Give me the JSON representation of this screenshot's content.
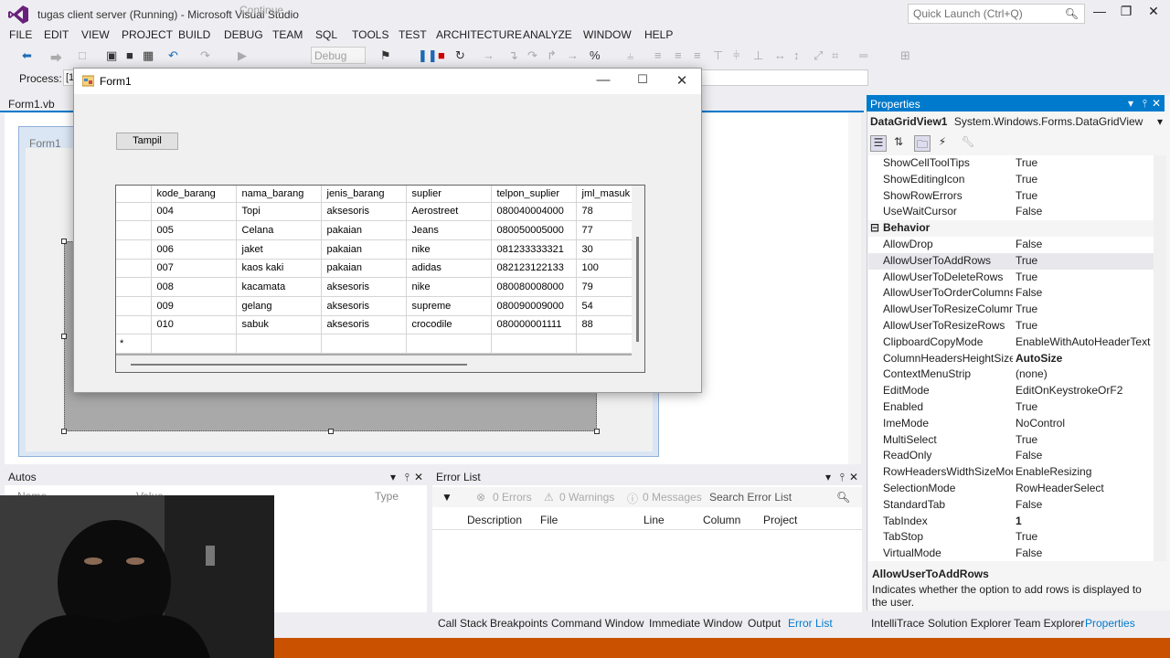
{
  "window": {
    "title": "tugas client server (Running) - Microsoft Visual Studio"
  },
  "quick_launch": {
    "placeholder": "Quick Launch (Ctrl+Q)"
  },
  "menu": [
    "FILE",
    "EDIT",
    "VIEW",
    "PROJECT",
    "BUILD",
    "DEBUG",
    "TEAM",
    "SQL",
    "TOOLS",
    "TEST",
    "ARCHITECTURE",
    "ANALYZE",
    "WINDOW",
    "HELP"
  ],
  "toolbar": {
    "continue_label": "Continue",
    "config_value": "Debug"
  },
  "process": {
    "label": "Process:",
    "value": "[1"
  },
  "document_tab": {
    "label": "Form1.vb"
  },
  "designer": {
    "form_title": "Form1"
  },
  "form1": {
    "title": "Form1",
    "button_label": "Tampil",
    "grid": {
      "columns": [
        "kode_barang",
        "nama_barang",
        "jenis_barang",
        "suplier",
        "telpon_suplier",
        "jml_masuk"
      ],
      "rows": [
        [
          "004",
          "Topi",
          "aksesoris",
          "Aerostreet",
          "080040004000",
          "78"
        ],
        [
          "005",
          "Celana",
          "pakaian",
          "Jeans",
          "080050005000",
          "77"
        ],
        [
          "006",
          "jaket",
          "pakaian",
          "nike",
          "081233333321",
          "30"
        ],
        [
          "007",
          "kaos kaki",
          "pakaian",
          "adidas",
          "082123122133",
          "100"
        ],
        [
          "008",
          "kacamata",
          "aksesoris",
          "nike",
          "080080008000",
          "79"
        ],
        [
          "009",
          "gelang",
          "aksesoris",
          "supreme",
          "080090009000",
          "54"
        ],
        [
          "010",
          "sabuk",
          "aksesoris",
          "crocodile",
          "080000001111",
          "88"
        ]
      ],
      "new_row_marker": "*"
    }
  },
  "properties": {
    "title": "Properties",
    "object_name": "DataGridView1",
    "object_type": "System.Windows.Forms.DataGridView",
    "rows": [
      {
        "name": "ShowCellToolTips",
        "value": "True"
      },
      {
        "name": "ShowEditingIcon",
        "value": "True"
      },
      {
        "name": "ShowRowErrors",
        "value": "True"
      },
      {
        "name": "UseWaitCursor",
        "value": "False"
      },
      {
        "category": "Behavior"
      },
      {
        "name": "AllowDrop",
        "value": "False"
      },
      {
        "name": "AllowUserToAddRows",
        "value": "True"
      },
      {
        "name": "AllowUserToDeleteRows",
        "value": "True"
      },
      {
        "name": "AllowUserToOrderColumns",
        "value": "False"
      },
      {
        "name": "AllowUserToResizeColumns",
        "value": "True"
      },
      {
        "name": "AllowUserToResizeRows",
        "value": "True"
      },
      {
        "name": "ClipboardCopyMode",
        "value": "EnableWithAutoHeaderText"
      },
      {
        "name": "ColumnHeadersHeightSizeMode",
        "value": "AutoSize",
        "bold": true
      },
      {
        "name": "ContextMenuStrip",
        "value": "(none)"
      },
      {
        "name": "EditMode",
        "value": "EditOnKeystrokeOrF2"
      },
      {
        "name": "Enabled",
        "value": "True"
      },
      {
        "name": "ImeMode",
        "value": "NoControl"
      },
      {
        "name": "MultiSelect",
        "value": "True"
      },
      {
        "name": "ReadOnly",
        "value": "False"
      },
      {
        "name": "RowHeadersWidthSizeMode",
        "value": "EnableResizing"
      },
      {
        "name": "SelectionMode",
        "value": "RowHeaderSelect"
      },
      {
        "name": "StandardTab",
        "value": "False"
      },
      {
        "name": "TabIndex",
        "value": "1",
        "bold": true
      },
      {
        "name": "TabStop",
        "value": "True"
      },
      {
        "name": "VirtualMode",
        "value": "False"
      }
    ],
    "description_title": "AllowUserToAddRows",
    "description_text": "Indicates whether the option to add rows is displayed to the user.",
    "tabs": [
      "IntelliTrace",
      "Solution Explorer",
      "Team Explorer",
      "Properties"
    ]
  },
  "autos": {
    "title": "Autos",
    "columns": [
      "Name",
      "Value",
      "Type"
    ]
  },
  "error_list": {
    "title": "Error List",
    "errors": "0 Errors",
    "warnings": "0 Warnings",
    "messages": "0 Messages",
    "search_placeholder": "Search Error List",
    "columns": [
      "Description",
      "File",
      "Line",
      "Column",
      "Project"
    ],
    "tabs": [
      "Call Stack",
      "Breakpoints",
      "Command Window",
      "Immediate Window",
      "Output",
      "Error List"
    ]
  },
  "colors": {
    "accent": "#007acc",
    "status": "#ca5100"
  }
}
